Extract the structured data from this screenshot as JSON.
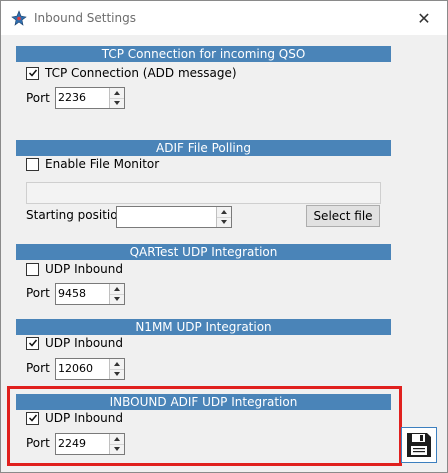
{
  "window": {
    "title": "Inbound Settings",
    "close_glyph": "✕"
  },
  "sections": {
    "tcp": {
      "header": "TCP Connection for incoming QSO",
      "checkbox_label": "TCP Connection (ADD message)",
      "checked": true,
      "port_label": "Port",
      "port_value": "2236"
    },
    "adif": {
      "header": "ADIF File Polling",
      "checkbox_label": "Enable File Monitor",
      "checked": false,
      "file_path": "",
      "starting_position_label": "Starting position",
      "starting_position_value": "",
      "select_file_label": "Select file"
    },
    "qartest": {
      "header": "QARTest UDP Integration",
      "checkbox_label": "UDP Inbound",
      "checked": false,
      "port_label": "Port",
      "port_value": "9458"
    },
    "n1mm": {
      "header": "N1MM UDP Integration",
      "checkbox_label": "UDP Inbound",
      "checked": true,
      "port_label": "Port",
      "port_value": "12060"
    },
    "inbound_adif": {
      "header": "INBOUND ADIF UDP Integration",
      "checkbox_label": "UDP Inbound",
      "checked": true,
      "port_label": "Port",
      "port_value": "2249"
    }
  },
  "icons": {
    "app": "app-logo-icon",
    "save": "floppy-disk-icon",
    "check": "checkmark-icon"
  },
  "colors": {
    "section_header_bg": "#4a84b8",
    "highlight_border": "#e0201e",
    "window_bg": "#f0f0f0"
  }
}
